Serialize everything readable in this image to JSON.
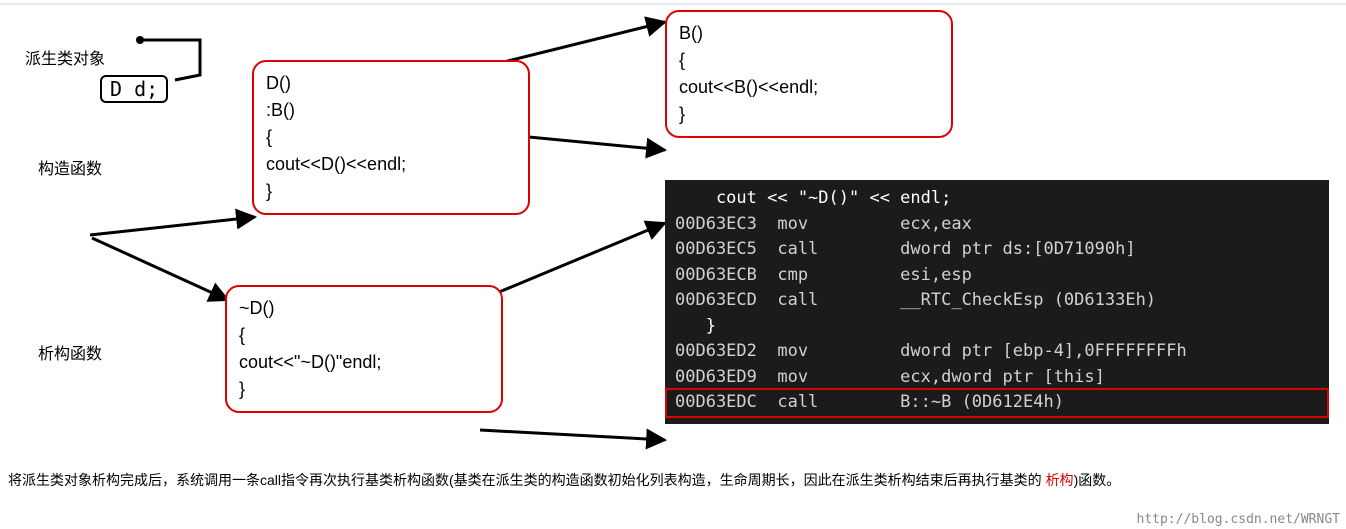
{
  "labels": {
    "derived_object": "派生类对象",
    "constructor": "构造函数",
    "destructor": "析构函数",
    "decl": "D d;"
  },
  "boxes": {
    "d_ctor": {
      "l1": "D()",
      "l2": "  :B()",
      "l3": "{",
      "l4": "   cout<<D()<<endl;",
      "l5": "}"
    },
    "b_ctor": {
      "l1": "B()",
      "l2": "{",
      "l3": "   cout<<B()<<endl;",
      "l4": "}"
    },
    "d_dtor": {
      "l1": "~D()",
      "l2": "{",
      "l3": "   cout<<\"~D()\"endl;",
      "l4": "}"
    }
  },
  "asm": {
    "title": "    cout << \"~D()\" << endl;",
    "r1": "00D63EC3  mov         ecx,eax",
    "r2": "00D63EC5  call        dword ptr ds:[0D71090h]",
    "r3": "00D63ECB  cmp         esi,esp",
    "r4": "00D63ECD  call        __RTC_CheckEsp (0D6133Eh)",
    "r5": "   }",
    "r6": "00D63ED2  mov         dword ptr [ebp-4],0FFFFFFFFh",
    "r7": "00D63ED9  mov         ecx,dword ptr [this]",
    "r8": "00D63EDC  call        B::~B (0D612E4h)"
  },
  "caption": {
    "t1": "将派生类对象析构完成后，系统调用一条call指令再次执行基类析构函数(基类在派生类的构造函数初始化列表构造，生命周期长，因此在派生类析构结束后再执行基类的 ",
    "red": "析构",
    "t2": ")函数。"
  },
  "watermark": "http://blog.csdn.net/WRNGT"
}
